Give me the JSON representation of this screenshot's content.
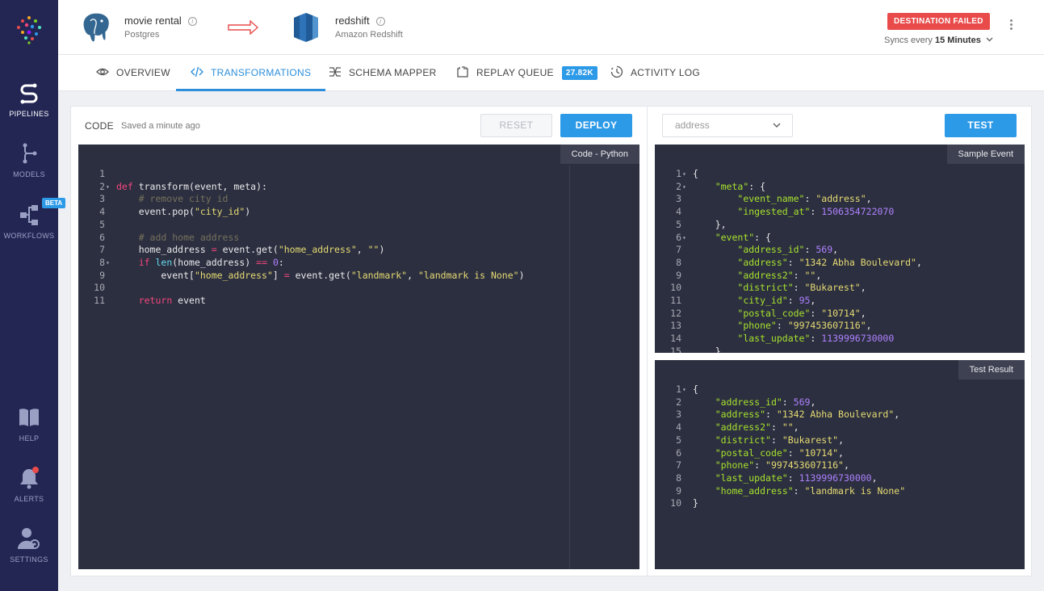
{
  "sidebar": {
    "items": [
      {
        "label": "PIPELINES",
        "icon": "pipelines-icon",
        "active": true
      },
      {
        "label": "MODELS",
        "icon": "models-icon"
      },
      {
        "label": "WORKFLOWS",
        "icon": "workflows-icon",
        "badge": "BETA"
      },
      {
        "label": "HELP",
        "icon": "help-book-icon"
      },
      {
        "label": "ALERTS",
        "icon": "bell-icon"
      },
      {
        "label": "SETTINGS",
        "icon": "user-settings-icon"
      }
    ]
  },
  "header": {
    "source": {
      "name": "movie rental",
      "type": "Postgres",
      "icon": "postgres-elephant-icon"
    },
    "destination": {
      "name": "redshift",
      "type": "Amazon Redshift",
      "icon": "redshift-icon"
    },
    "status_badge": "DESTINATION FAILED",
    "syncs_prefix": "Syncs every",
    "syncs_value": "15 Minutes",
    "colors": {
      "accent": "#2d9ae8",
      "danger": "#e94b4b",
      "sidebar": "#232653"
    }
  },
  "tabs": [
    {
      "label": "OVERVIEW",
      "icon": "eye-icon"
    },
    {
      "label": "TRANSFORMATIONS",
      "icon": "code-icon",
      "active": true
    },
    {
      "label": "SCHEMA MAPPER",
      "icon": "mapper-icon"
    },
    {
      "label": "REPLAY QUEUE",
      "icon": "replay-icon",
      "badge": "27.82K"
    },
    {
      "label": "ACTIVITY LOG",
      "icon": "activity-icon"
    }
  ],
  "code_panel": {
    "label": "CODE",
    "saved_text": "Saved a minute ago",
    "reset_label": "RESET",
    "deploy_label": "DEPLOY",
    "editor_label": "Code - Python",
    "lines": [
      "",
      "def transform(event, meta):",
      "    # remove city id",
      "    event.pop(\"city_id\")",
      "",
      "    # add home address",
      "    home_address = event.get(\"home_address\", \"\")",
      "    if len(home_address) == 0:",
      "        event[\"home_address\"] = event.get(\"landmark\", \"landmark is None\")",
      "",
      "    return event"
    ]
  },
  "test_panel": {
    "event_select_value": "address",
    "test_label": "TEST",
    "sample_label": "Sample Event",
    "result_label": "Test Result",
    "sample_lines": [
      "{",
      "    \"meta\": {",
      "        \"event_name\": \"address\",",
      "        \"ingested_at\": 1506354722070",
      "    },",
      "    \"event\": {",
      "        \"address_id\": 569,",
      "        \"address\": \"1342 Abha Boulevard\",",
      "        \"address2\": \"\",",
      "        \"district\": \"Bukarest\",",
      "        \"city_id\": 95,",
      "        \"postal_code\": \"10714\",",
      "        \"phone\": \"997453607116\",",
      "        \"last_update\": 1139996730000",
      "    }",
      "}"
    ],
    "result_lines": [
      "{",
      "    \"address_id\": 569,",
      "    \"address\": \"1342 Abha Boulevard\",",
      "    \"address2\": \"\",",
      "    \"district\": \"Bukarest\",",
      "    \"postal_code\": \"10714\",",
      "    \"phone\": \"997453607116\",",
      "    \"last_update\": 1139996730000,",
      "    \"home_address\": \"landmark is None\"",
      "}"
    ]
  }
}
